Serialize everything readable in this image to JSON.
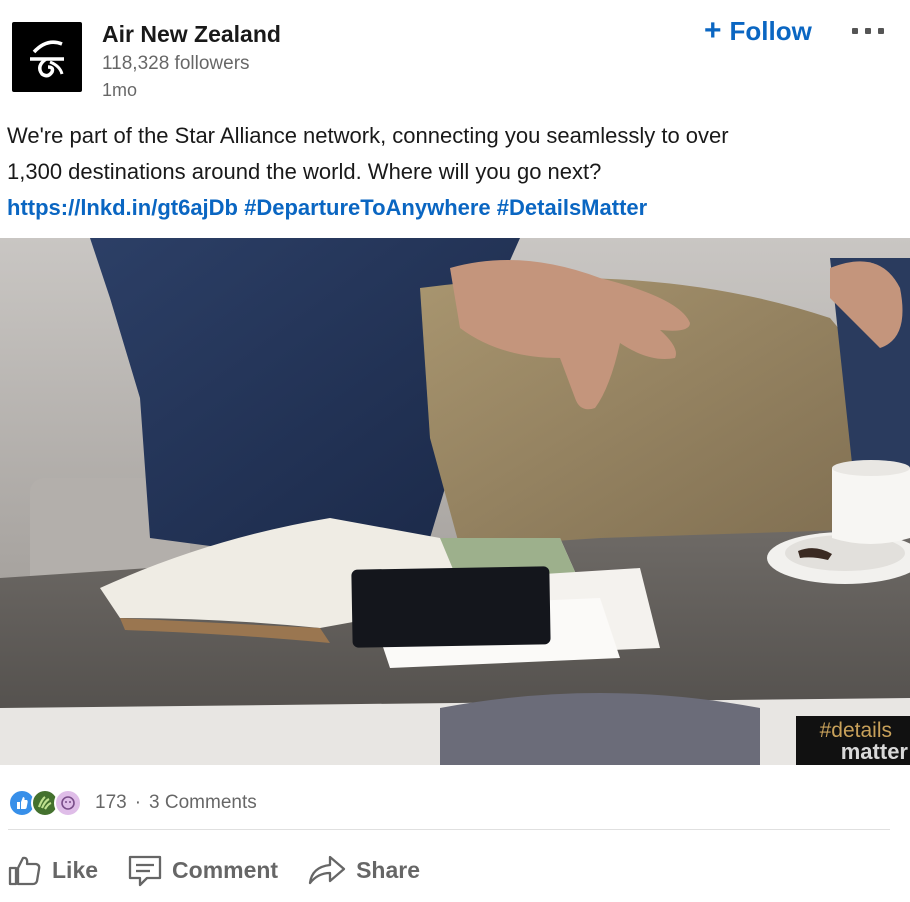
{
  "company": {
    "name": "Air New Zealand",
    "followers": "118,328 followers",
    "age": "1mo",
    "logo_icon": "koru-icon"
  },
  "header_actions": {
    "follow_label": "Follow",
    "follow_icon": "plus-icon",
    "more_icon": "ellipsis-icon"
  },
  "post": {
    "text_line1": "We're part of the Star Alliance network, connecting you seamlessly to over",
    "text_line2": "1,300 destinations around the world. Where will you go next?",
    "link": "https://lnkd.in/gt6ajDb",
    "hashtags": [
      "#DepartureToAnywhere",
      "#DetailsMatter"
    ]
  },
  "image": {
    "badge_line1": "#details",
    "badge_line2": "matter"
  },
  "social": {
    "reaction_icons": [
      "like-icon",
      "celebrate-icon",
      "curious-icon"
    ],
    "reaction_count": "173",
    "separator": "·",
    "comments": "3 Comments"
  },
  "actions": [
    {
      "label": "Like",
      "icon": "thumbs-up-icon"
    },
    {
      "label": "Comment",
      "icon": "comment-icon"
    },
    {
      "label": "Share",
      "icon": "share-icon"
    }
  ],
  "colors": {
    "brand_blue": "#0a66c2",
    "muted_text": "#666666",
    "badge_gold": "#c8a15a"
  }
}
